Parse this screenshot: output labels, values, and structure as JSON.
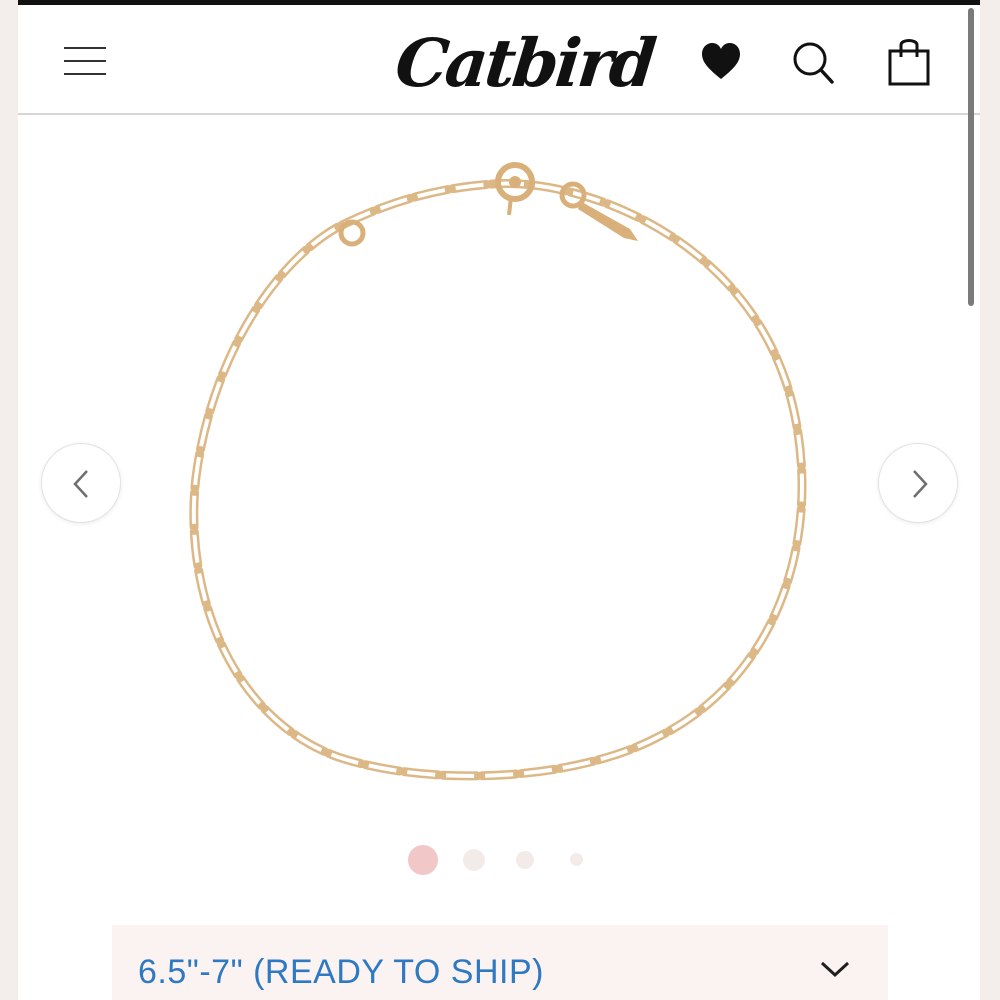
{
  "header": {
    "logo_text": "Catbird",
    "icons": [
      "menu-icon",
      "heart-icon",
      "search-icon",
      "shopping-bag-icon"
    ]
  },
  "product_image": {
    "subject": "gold paperclip chain bracelet with spring ring clasp"
  },
  "carousel": {
    "prev_icon": "chevron-left-icon",
    "next_icon": "chevron-right-icon",
    "dot_count": 4,
    "active_index": 0
  },
  "size_select": {
    "selected": "6.5\"-7\" (READY TO SHIP)",
    "icon": "chevron-down-icon"
  },
  "colors": {
    "accent_blue": "#2f79c2",
    "active_dot": "#f2c7c7",
    "inactive_dot": "#f2ebe8",
    "select_bg": "#fbf3f1",
    "gold": "#d9b07a"
  }
}
